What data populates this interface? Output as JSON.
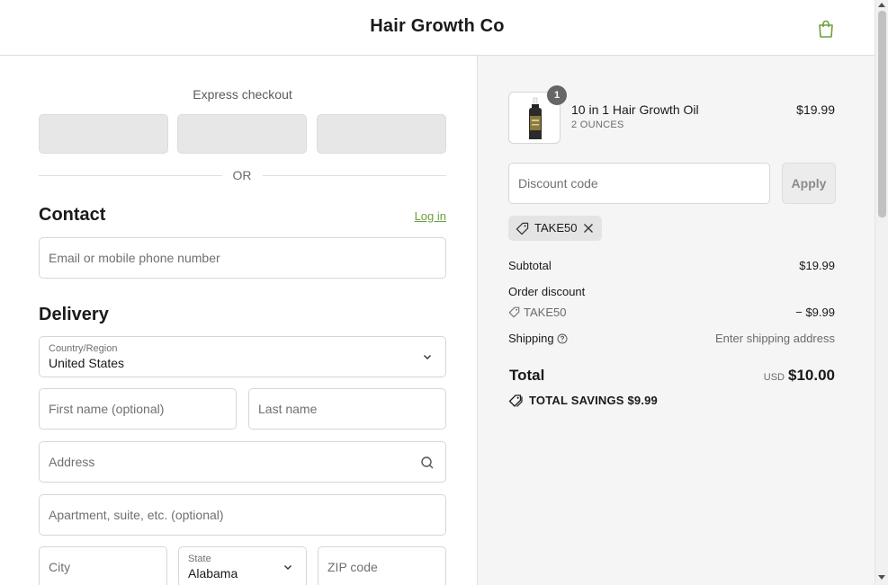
{
  "header": {
    "brand": "Hair Growth Co",
    "cart_icon": "shopping-bag-icon",
    "accent": "#6aa23c"
  },
  "express": {
    "label": "Express checkout",
    "or": "OR",
    "buttons": [
      "",
      "",
      ""
    ]
  },
  "contact": {
    "title": "Contact",
    "login": "Log in",
    "email_placeholder": "Email or mobile phone number"
  },
  "delivery": {
    "title": "Delivery",
    "country_label": "Country/Region",
    "country_value": "United States",
    "first_name_placeholder": "First name (optional)",
    "last_name_placeholder": "Last name",
    "address_placeholder": "Address",
    "apartment_placeholder": "Apartment, suite, etc. (optional)",
    "city_placeholder": "City",
    "state_label": "State",
    "state_value": "Alabama",
    "zip_placeholder": "ZIP code"
  },
  "summary": {
    "product": {
      "name": "10 in 1 Hair Growth Oil",
      "variant": "2 OUNCES",
      "price": "$19.99",
      "quantity": "1"
    },
    "discount_placeholder": "Discount code",
    "apply": "Apply",
    "applied_code": "TAKE50",
    "subtotal_label": "Subtotal",
    "subtotal_value": "$19.99",
    "order_discount_label": "Order discount",
    "discount_code": "TAKE50",
    "discount_value": "− $9.99",
    "shipping_label": "Shipping",
    "shipping_value": "Enter shipping address",
    "total_label": "Total",
    "total_currency": "USD",
    "total_value": "$10.00",
    "savings": "TOTAL SAVINGS  $9.99"
  }
}
